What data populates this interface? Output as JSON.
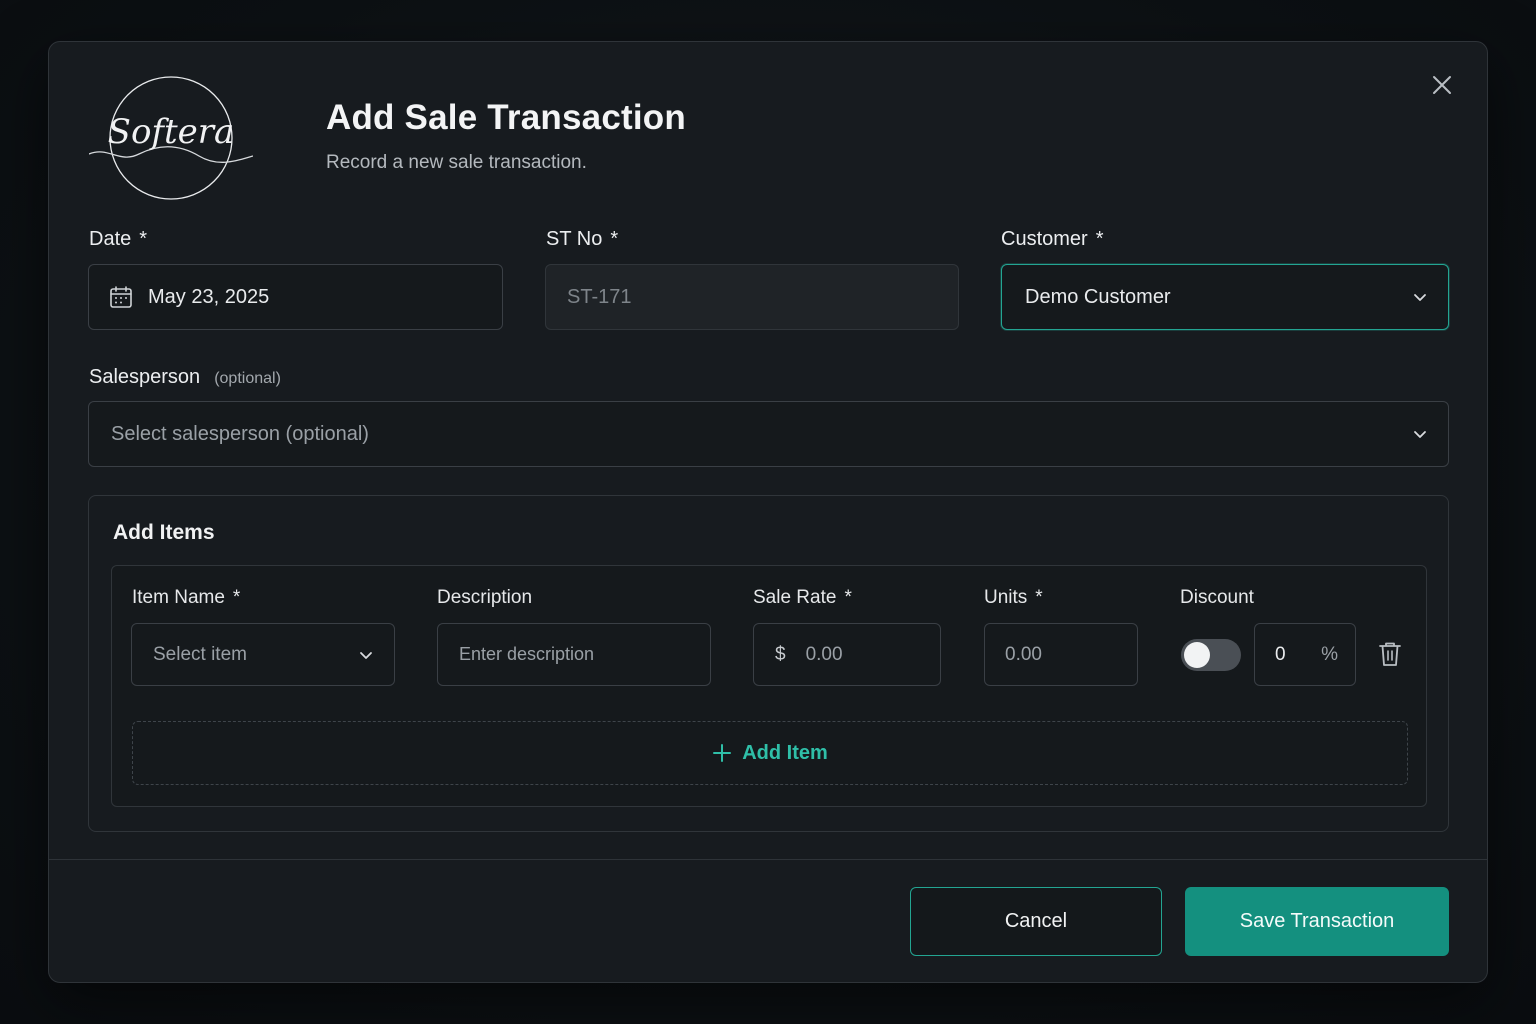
{
  "header": {
    "title": "Add Sale Transaction",
    "subtitle": "Record a new sale transaction.",
    "logo_text": "Softera"
  },
  "form": {
    "date": {
      "label": "Date",
      "required_mark": "*",
      "value": "May 23, 2025"
    },
    "st_no": {
      "label": "ST No",
      "required_mark": "*",
      "value": "ST-171"
    },
    "customer": {
      "label": "Customer",
      "required_mark": "*",
      "value": "Demo Customer"
    },
    "salesperson": {
      "label": "Salesperson",
      "optional_text": "(optional)",
      "placeholder": "Select salesperson (optional)"
    }
  },
  "items": {
    "title": "Add Items",
    "columns": {
      "item_name": "Item Name",
      "description": "Description",
      "sale_rate": "Sale Rate",
      "units": "Units",
      "discount": "Discount"
    },
    "required_mark": "*",
    "row": {
      "item_placeholder": "Select item",
      "description_placeholder": "Enter description",
      "currency_symbol": "$",
      "rate_placeholder": "0.00",
      "units_placeholder": "0.00",
      "discount_value": "0",
      "discount_unit": "%",
      "discount_toggle_on": false
    },
    "add_item_label": "Add Item"
  },
  "footer": {
    "cancel_label": "Cancel",
    "save_label": "Save Transaction"
  },
  "colors": {
    "accent": "#14907f",
    "accent_text": "#2fbfa8",
    "background": "#171b1f"
  }
}
